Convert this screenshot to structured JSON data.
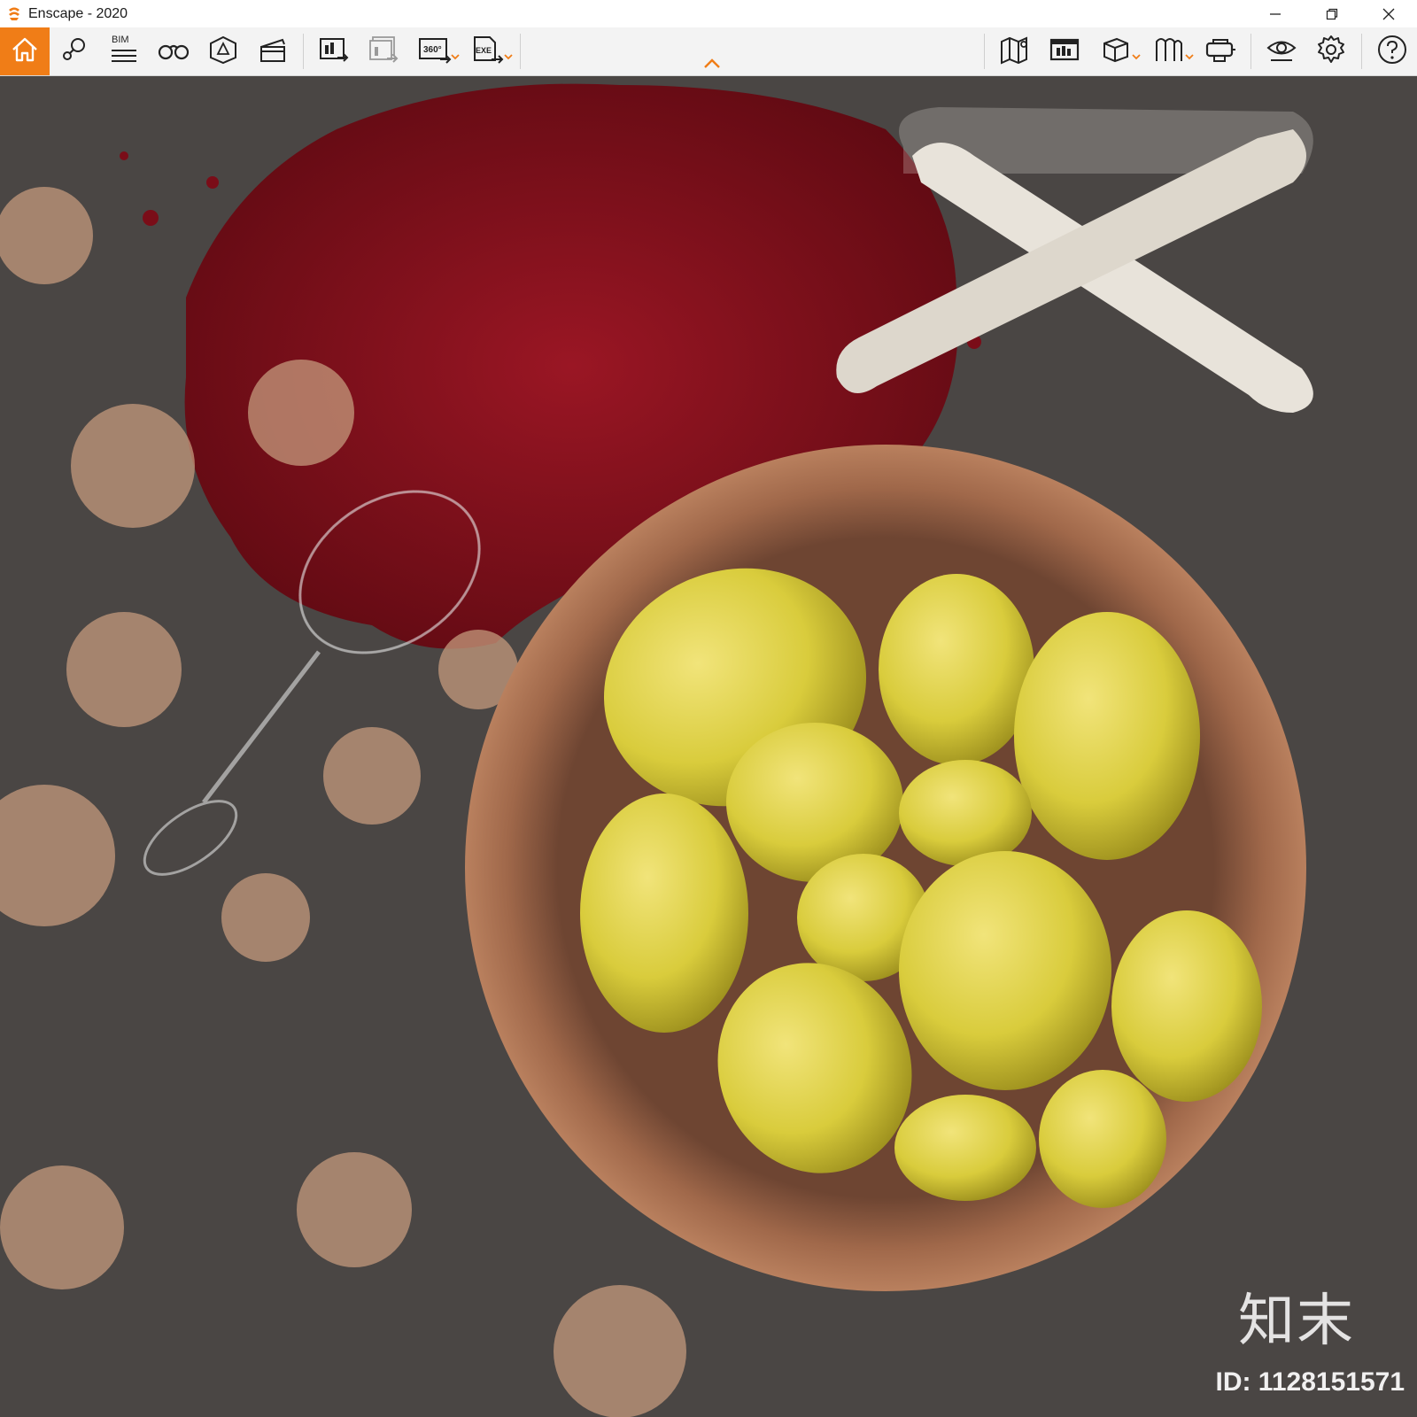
{
  "window": {
    "title": "Enscape - 2020",
    "controls": [
      "minimize-icon",
      "restore-icon",
      "close-icon"
    ]
  },
  "toolbar": {
    "accent_color": "#f07d17",
    "groups": [
      [
        "home-icon",
        "location-pin-icon",
        "bim-list-icon",
        "binoculars-icon",
        "perspective-cube-icon",
        "clapperboard-icon"
      ],
      [
        "render-screenshot-icon",
        "batch-render-icon",
        "panorama-360-icon",
        "exe-export-icon"
      ],
      [
        "map-icon",
        "asset-library-icon",
        "box-icon",
        "book-icon",
        "vr-headset-icon"
      ],
      [
        "eye-icon",
        "settings-icon"
      ],
      [
        "help-icon"
      ]
    ],
    "bim_label": "BIM",
    "panorama_label": "360°",
    "exe_label": "EXE"
  },
  "scene": {
    "description_colors": {
      "table": "#4a4644",
      "wine": "#7a0d18",
      "bowl": "#a0684a",
      "lemon": "#d9cc3c",
      "chair": "#e8e3da",
      "flowers": "#c49a7c"
    }
  },
  "watermark": {
    "brand": "知末",
    "id_text": "ID: 1128151571"
  }
}
